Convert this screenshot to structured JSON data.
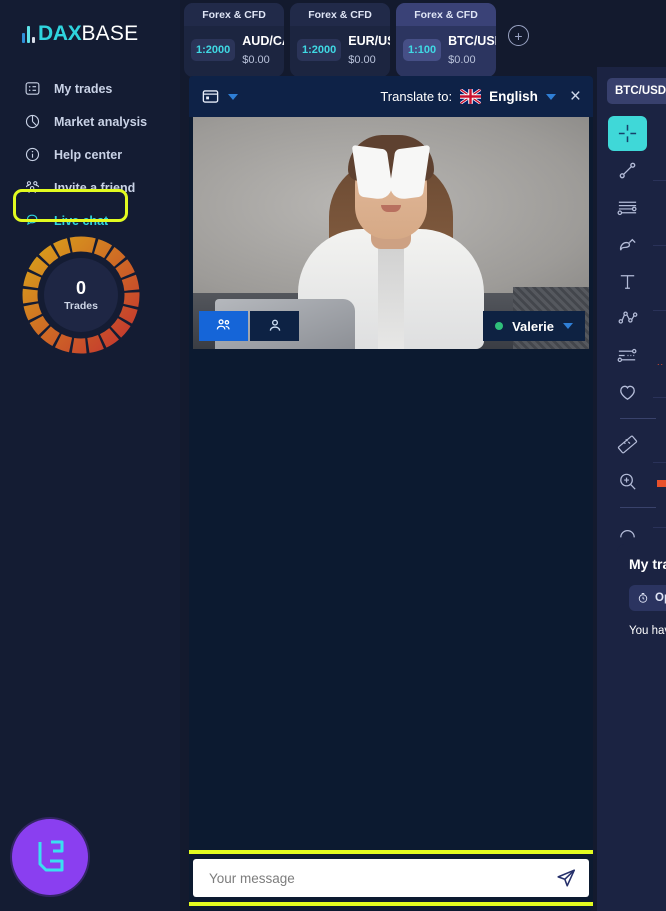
{
  "brand": {
    "dax": "DAX",
    "base": "BASE"
  },
  "sidebar": {
    "items": [
      {
        "label": "My trades",
        "icon": "list-card-icon"
      },
      {
        "label": "Market analysis",
        "icon": "pie-chart-icon"
      },
      {
        "label": "Help center",
        "icon": "info-circle-icon"
      },
      {
        "label": "Invite a friend",
        "icon": "people-group-icon"
      },
      {
        "label": "Live chat",
        "icon": "chat-bubble-icon",
        "active": true
      }
    ],
    "donut": {
      "value": "0",
      "label": "Trades"
    },
    "accent_highlight": "#e2fb20",
    "accent_active": "#2fd4de"
  },
  "topbar": {
    "tabs": [
      {
        "kind": "Forex & CFD",
        "leverage": "1:2000",
        "pair": "AUD/CAD",
        "amount": "$0.00",
        "active": false
      },
      {
        "kind": "Forex & CFD",
        "leverage": "1:2000",
        "pair": "EUR/USD",
        "amount": "$0.00",
        "active": false
      },
      {
        "kind": "Forex & CFD",
        "leverage": "1:100",
        "pair": "BTC/USDT",
        "amount": "$0.00",
        "active": true
      }
    ],
    "add_tab_label": "+"
  },
  "chat": {
    "header": {
      "window_icon": "window-card-icon",
      "translate_label": "Translate to:",
      "language": "English",
      "flag": "uk-flag-icon",
      "close_label": "×"
    },
    "video": {
      "group_view_icon": "people-group-icon",
      "single_view_icon": "person-icon",
      "participant": "Valerie",
      "status": "online"
    },
    "composer": {
      "placeholder": "Your message",
      "value": "",
      "send_icon": "send-paper-plane-icon"
    }
  },
  "chart_panel": {
    "symbol": "BTC/USDT",
    "tools": [
      {
        "name": "crosshair-tool",
        "active": true
      },
      {
        "name": "trend-line-tool",
        "active": false
      },
      {
        "name": "horizontal-lines-tool",
        "active": false
      },
      {
        "name": "brush-tool",
        "active": false
      },
      {
        "name": "text-tool",
        "active": false
      },
      {
        "name": "fibonacci-tool",
        "active": false
      },
      {
        "name": "forecast-tool",
        "active": false
      },
      {
        "name": "favorite-tool",
        "active": false
      },
      {
        "name": "measure-tool",
        "active": false
      },
      {
        "name": "zoom-tool",
        "active": false
      },
      {
        "name": "arc-tool",
        "active": false
      }
    ]
  },
  "my_trades": {
    "title": "My trades",
    "tab_open": "Open",
    "empty_text": "You have"
  }
}
